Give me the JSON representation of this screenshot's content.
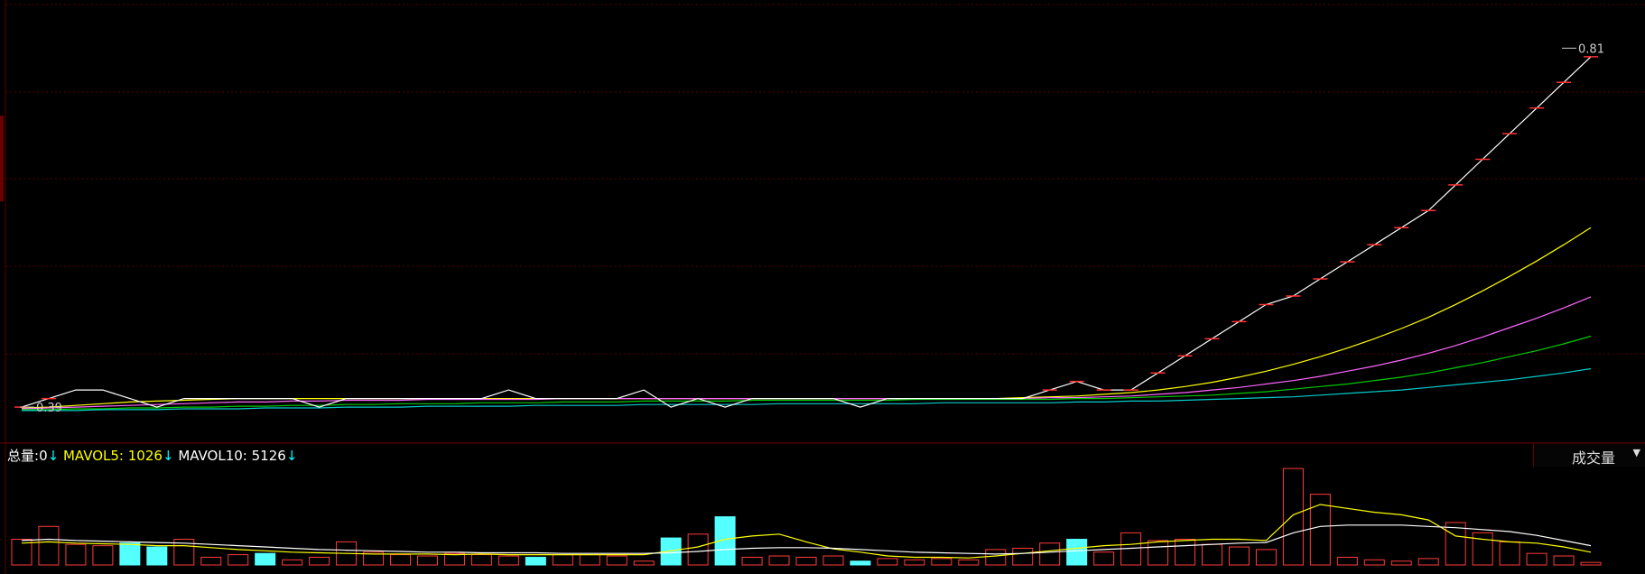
{
  "indicator": {
    "total_label": "总量:",
    "total_value": "0",
    "mavol5_label": "MAVOL5:",
    "mavol5_value": "1026",
    "mavol10_label": "MAVOL10:",
    "mavol10_value": "5126",
    "down_arrow": "↓",
    "dropdown_label": "成交量",
    "dropdown_arrow": "▼",
    "colors": {
      "total": "#ffffff",
      "mavol5": "#ffff00",
      "mavol10": "#ffffff",
      "arrow": "#00ffff"
    }
  },
  "chart_data": [
    {
      "type": "line",
      "panel": "price",
      "grid": true,
      "annotations": [
        {
          "text": "0.39",
          "index": 0,
          "value": 0.39
        },
        {
          "text": "0.81",
          "index": 57,
          "value": 0.81
        }
      ],
      "x": [
        0,
        1,
        2,
        3,
        4,
        5,
        6,
        7,
        8,
        9,
        10,
        11,
        12,
        13,
        14,
        15,
        16,
        17,
        18,
        19,
        20,
        21,
        22,
        23,
        24,
        25,
        26,
        27,
        28,
        29,
        30,
        31,
        32,
        33,
        34,
        35,
        36,
        37,
        38,
        39,
        40,
        41,
        42,
        43,
        44,
        45,
        46,
        47,
        48,
        49,
        50,
        51,
        52,
        53,
        54,
        55,
        56,
        57,
        58
      ],
      "series": [
        {
          "color": "#ffffff",
          "values": [
            0.39,
            0.4,
            0.41,
            0.41,
            0.4,
            0.39,
            0.4,
            0.4,
            0.4,
            0.4,
            0.4,
            0.39,
            0.4,
            0.4,
            0.4,
            0.4,
            0.4,
            0.4,
            0.41,
            0.4,
            0.4,
            0.4,
            0.4,
            0.41,
            0.39,
            0.4,
            0.39,
            0.4,
            0.4,
            0.4,
            0.4,
            0.39,
            0.4,
            0.4,
            0.4,
            0.4,
            0.4,
            0.4,
            0.41,
            0.42,
            0.41,
            0.41,
            0.43,
            0.45,
            0.47,
            0.49,
            0.51,
            0.52,
            0.54,
            0.56,
            0.58,
            0.6,
            0.62,
            0.65,
            0.68,
            0.71,
            0.74,
            0.77,
            0.8
          ]
        },
        {
          "color": "#ffff00",
          "values": [
            0.389,
            0.39,
            0.392,
            0.394,
            0.396,
            0.397,
            0.398,
            0.399,
            0.4,
            0.4,
            0.4,
            0.4,
            0.4,
            0.4,
            0.4,
            0.4,
            0.4,
            0.4,
            0.4,
            0.4,
            0.4,
            0.4,
            0.4,
            0.4,
            0.4,
            0.4,
            0.4,
            0.4,
            0.4,
            0.4,
            0.4,
            0.4,
            0.4,
            0.4,
            0.4,
            0.4,
            0.4,
            0.401,
            0.402,
            0.403,
            0.405,
            0.407,
            0.41,
            0.414,
            0.419,
            0.425,
            0.432,
            0.44,
            0.449,
            0.459,
            0.47,
            0.482,
            0.495,
            0.51,
            0.526,
            0.543,
            0.561,
            0.58,
            0.6
          ]
        },
        {
          "color": "#ff66ff",
          "values": [
            0.388,
            0.389,
            0.39,
            0.391,
            0.392,
            0.393,
            0.394,
            0.395,
            0.396,
            0.396,
            0.397,
            0.397,
            0.398,
            0.398,
            0.398,
            0.399,
            0.399,
            0.399,
            0.399,
            0.399,
            0.4,
            0.4,
            0.4,
            0.4,
            0.4,
            0.4,
            0.4,
            0.4,
            0.4,
            0.4,
            0.4,
            0.4,
            0.4,
            0.4,
            0.4,
            0.4,
            0.4,
            0.4,
            0.401,
            0.401,
            0.402,
            0.403,
            0.405,
            0.407,
            0.41,
            0.413,
            0.417,
            0.421,
            0.426,
            0.432,
            0.438,
            0.445,
            0.453,
            0.462,
            0.472,
            0.483,
            0.494,
            0.506,
            0.519
          ]
        },
        {
          "color": "#00cc00",
          "values": [
            0.387,
            0.387,
            0.388,
            0.388,
            0.389,
            0.389,
            0.39,
            0.39,
            0.391,
            0.391,
            0.392,
            0.392,
            0.393,
            0.393,
            0.394,
            0.394,
            0.394,
            0.395,
            0.395,
            0.395,
            0.396,
            0.396,
            0.396,
            0.397,
            0.397,
            0.397,
            0.397,
            0.398,
            0.398,
            0.398,
            0.398,
            0.398,
            0.398,
            0.399,
            0.399,
            0.399,
            0.399,
            0.399,
            0.399,
            0.4,
            0.4,
            0.401,
            0.402,
            0.403,
            0.404,
            0.406,
            0.408,
            0.411,
            0.414,
            0.417,
            0.421,
            0.425,
            0.43,
            0.436,
            0.442,
            0.449,
            0.456,
            0.464,
            0.473
          ]
        },
        {
          "color": "#00cccc",
          "values": [
            0.386,
            0.386,
            0.386,
            0.387,
            0.387,
            0.387,
            0.388,
            0.388,
            0.388,
            0.389,
            0.389,
            0.389,
            0.39,
            0.39,
            0.39,
            0.391,
            0.391,
            0.391,
            0.391,
            0.392,
            0.392,
            0.392,
            0.392,
            0.393,
            0.393,
            0.393,
            0.393,
            0.393,
            0.394,
            0.394,
            0.394,
            0.394,
            0.394,
            0.394,
            0.395,
            0.395,
            0.395,
            0.395,
            0.395,
            0.396,
            0.396,
            0.397,
            0.397,
            0.398,
            0.399,
            0.4,
            0.401,
            0.402,
            0.404,
            0.406,
            0.408,
            0.41,
            0.413,
            0.416,
            0.419,
            0.422,
            0.426,
            0.43,
            0.435
          ]
        }
      ],
      "ylim": [
        0.37,
        0.84
      ]
    },
    {
      "type": "bar",
      "panel": "volume",
      "x": [
        0,
        1,
        2,
        3,
        4,
        5,
        6,
        7,
        8,
        9,
        10,
        11,
        12,
        13,
        14,
        15,
        16,
        17,
        18,
        19,
        20,
        21,
        22,
        23,
        24,
        25,
        26,
        27,
        28,
        29,
        30,
        31,
        32,
        33,
        34,
        35,
        36,
        37,
        38,
        39,
        40,
        41,
        42,
        43,
        44,
        45,
        46,
        47,
        48,
        49,
        50,
        51,
        52,
        53,
        54,
        55,
        56,
        57,
        58
      ],
      "values": [
        40,
        60,
        32,
        30,
        34,
        28,
        40,
        12,
        16,
        18,
        8,
        12,
        36,
        20,
        16,
        14,
        18,
        16,
        14,
        12,
        16,
        16,
        14,
        6,
        42,
        48,
        75,
        12,
        14,
        12,
        14,
        6,
        10,
        8,
        10,
        8,
        24,
        26,
        34,
        40,
        20,
        50,
        38,
        40,
        32,
        28,
        24,
        150,
        110,
        12,
        8,
        6,
        10,
        66,
        50,
        36,
        18,
        14,
        4
      ],
      "down": [
        false,
        false,
        false,
        false,
        true,
        true,
        false,
        false,
        false,
        true,
        false,
        false,
        false,
        false,
        false,
        false,
        false,
        false,
        false,
        true,
        false,
        false,
        false,
        false,
        true,
        false,
        true,
        false,
        false,
        false,
        false,
        true,
        false,
        false,
        false,
        false,
        false,
        false,
        false,
        true,
        false,
        false,
        false,
        false,
        false,
        false,
        false,
        false,
        false,
        false,
        false,
        false,
        false,
        false,
        false,
        false,
        false,
        false,
        false
      ],
      "series": [
        {
          "name": "MAVOL5",
          "color": "#ffff00",
          "values": [
            34,
            36,
            34,
            33,
            32,
            30,
            30,
            27,
            24,
            22,
            20,
            19,
            18,
            17,
            17,
            17,
            16,
            17,
            16,
            16,
            16,
            16,
            16,
            16,
            22,
            28,
            40,
            45,
            48,
            36,
            25,
            20,
            14,
            12,
            12,
            11,
            14,
            18,
            22,
            26,
            30,
            32,
            36,
            38,
            40,
            40,
            38,
            78,
            94,
            88,
            82,
            78,
            70,
            45,
            40,
            36,
            34,
            28,
            20
          ]
        },
        {
          "name": "MAVOL10",
          "color": "#ffffff",
          "values": [
            38,
            40,
            38,
            37,
            36,
            35,
            34,
            32,
            30,
            28,
            26,
            24,
            23,
            22,
            21,
            20,
            20,
            19,
            19,
            19,
            18,
            18,
            18,
            18,
            19,
            21,
            24,
            26,
            27,
            27,
            26,
            24,
            22,
            20,
            19,
            18,
            17,
            18,
            20,
            22,
            24,
            26,
            28,
            30,
            32,
            34,
            35,
            50,
            60,
            62,
            62,
            62,
            60,
            58,
            55,
            52,
            46,
            38,
            30
          ]
        }
      ],
      "ylim": [
        0,
        160
      ]
    }
  ]
}
